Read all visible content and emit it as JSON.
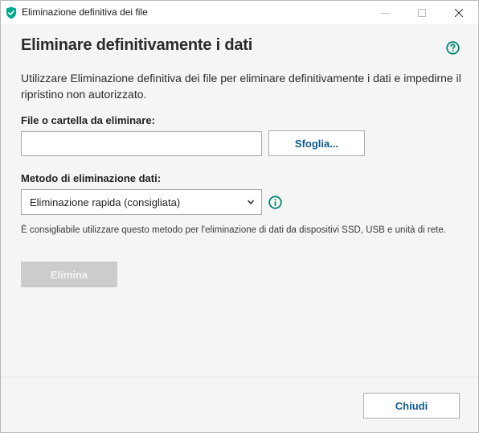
{
  "window": {
    "title": "Eliminazione definitiva dei file",
    "accent_color": "#00a88e",
    "app_icon": "kaspersky-shield-icon"
  },
  "main": {
    "heading": "Eliminare definitivamente i dati",
    "description": "Utilizzare Eliminazione definitiva dei file per eliminare definitivamente i dati e impedirne il ripristino non autorizzato.",
    "file_label": "File o cartella da eliminare:",
    "file_input_value": "",
    "browse_label": "Sfoglia...",
    "method_label": "Metodo di eliminazione dati:",
    "method_selected": "Eliminazione rapida (consigliata)",
    "method_note": "È consigliabile utilizzare questo metodo per l'eliminazione di dati da dispositivi SSD, USB e unità di rete.",
    "delete_label": "Elimina",
    "delete_enabled": false
  },
  "footer": {
    "close_label": "Chiudi"
  }
}
